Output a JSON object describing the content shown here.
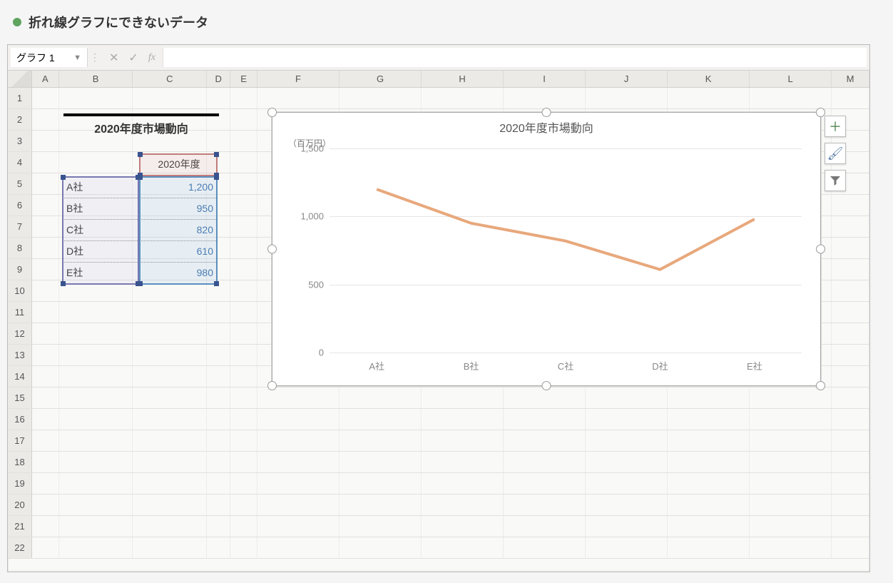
{
  "article_heading": "折れ線グラフにできないデータ",
  "name_box": {
    "value": "グラフ 1"
  },
  "columns": [
    "A",
    "B",
    "C",
    "D",
    "E",
    "F",
    "G",
    "H",
    "I",
    "J",
    "K",
    "L",
    "M"
  ],
  "rows_visible": 22,
  "table": {
    "title": "2020年度市場動向",
    "header": "2020年度",
    "rows": [
      {
        "label": "A社",
        "value": "1,200"
      },
      {
        "label": "B社",
        "value": "950"
      },
      {
        "label": "C社",
        "value": "820"
      },
      {
        "label": "D社",
        "value": "610"
      },
      {
        "label": "E社",
        "value": "980"
      }
    ]
  },
  "chart": {
    "title": "2020年度市場動向",
    "unit": "（百万円）"
  },
  "chart_data": {
    "type": "line",
    "title": "2020年度市場動向",
    "xlabel": "",
    "ylabel": "（百万円）",
    "categories": [
      "A社",
      "B社",
      "C社",
      "D社",
      "E社"
    ],
    "series": [
      {
        "name": "2020年度",
        "values": [
          1200,
          950,
          820,
          610,
          980
        ]
      }
    ],
    "ylim": [
      0,
      1500
    ],
    "yticks": [
      0,
      500,
      1000,
      1500
    ]
  }
}
